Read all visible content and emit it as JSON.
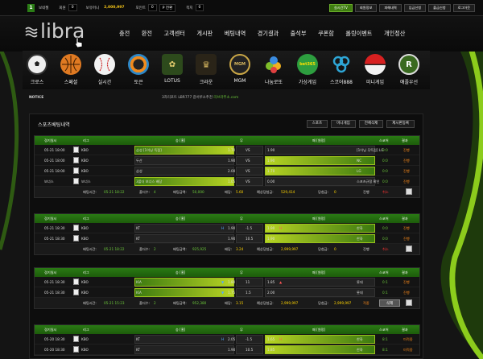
{
  "topbar": {
    "level": "1",
    "user_label": "보네젤",
    "hold_label": "회원",
    "hold_value": "0",
    "money_label": "보유머니",
    "money_value": "2,000,997",
    "point_label": "포인트",
    "point_value": "0",
    "p_btn": "P 전환",
    "note_label": "쪽지",
    "note_value": "0",
    "buttons": [
      "실시간TV",
      "회원정보",
      "피해내역",
      "입금신청",
      "출금신청",
      "로그아웃"
    ]
  },
  "logo": {
    "text": "libra"
  },
  "nav": [
    "충전",
    "환전",
    "고객센터",
    "게시판",
    "베팅내역",
    "경기결과",
    "출석부",
    "쿠폰함",
    "롤링이벤트",
    "개인정산"
  ],
  "games": [
    {
      "label": "크로스",
      "color": "#e8e8e8"
    },
    {
      "label": "스페셜",
      "color": "#e07a22"
    },
    {
      "label": "실시간",
      "color": "#eeeeee"
    },
    {
      "label": "토큰",
      "color": "#2e88c8"
    },
    {
      "label": "LOTUS",
      "color": "#3a6e2c"
    },
    {
      "label": "크라운",
      "color": "#3c3420"
    },
    {
      "label": "MGM",
      "color": "#2c2c2c"
    },
    {
      "label": "나눔로또",
      "color": "#7fbd2a"
    },
    {
      "label": "가상게임",
      "color": "#2d9e3f"
    },
    {
      "label": "스코어888",
      "color": "#2ea6d6"
    },
    {
      "label": "미니게임",
      "color": "#eeeeee"
    },
    {
      "label": "애플우선",
      "color": "#3a6a20"
    }
  ],
  "notice": {
    "label": "NOTICE",
    "text": "3차리포트 LBR777 갈서루소추천",
    "link": "리브라주소.com"
  },
  "panel": {
    "title": "스포츠베팅내역",
    "tabs": [
      "스포츠",
      "미니게임",
      "전체삭제",
      "제시판등록"
    ]
  },
  "headers": [
    "경기일시",
    "리그",
    "승 [홈]",
    "무",
    "패 [원정]",
    "스코어",
    "결과"
  ],
  "bets": [
    {
      "rows": [
        {
          "time": "05-21 18:00",
          "league": "KBO",
          "home": "삼성 [1이닝 득점]",
          "home_odds": "1.70",
          "draw": "VS",
          "away_odds": "1.90",
          "away": "[1이닝 무득점] LG",
          "score": "0:0",
          "result": "진행",
          "sel": "home"
        },
        {
          "time": "05-21 18:00",
          "league": "KBO",
          "home": "두산",
          "home_odds": "1.90",
          "draw": "VS",
          "away_odds": "1.90",
          "away": "NC",
          "score": "0:0",
          "result": "진행",
          "sel": "away"
        },
        {
          "time": "05-21 18:00",
          "league": "KBO",
          "home": "삼성",
          "home_odds": "2.00",
          "draw": "VS",
          "away_odds": "1.70",
          "away": "LG",
          "score": "0:0",
          "result": "진행",
          "sel": "away"
        },
        {
          "time": "보너스",
          "league": "보너스",
          "home": "3폴더 보너스 배당",
          "home_odds": "1.05",
          "draw": "VS",
          "away_odds": "0.00",
          "away": "스포츠규정 확인",
          "score": "0:0",
          "result": "진행",
          "sel": "home"
        }
      ],
      "foot": {
        "time_label": "배팅시간:",
        "time": "05-21 18:22",
        "folder_label": "폴더수:",
        "folder": "4",
        "amt_label": "배팅금액:",
        "amt": "50,000",
        "odds_label": "배당:",
        "odds": "5.60",
        "exp_label": "예상당첨금:",
        "exp": "529,414",
        "win_label": "당첨금:",
        "win": "0",
        "status": "진행",
        "cancel": "취소"
      }
    },
    {
      "rows": [
        {
          "time": "05-21 18:30",
          "league": "KBO",
          "home": "KT",
          "mark": "H",
          "home_odds": "1.90",
          "draw": "-1.5",
          "away_odds": "1.90",
          "away_mark": "H",
          "away": "한화",
          "score": "0:0",
          "result": "진행",
          "sel": "away"
        },
        {
          "time": "05-21 18:30",
          "league": "KBO",
          "home": "KT",
          "mark": "",
          "home_odds": "1.90",
          "draw": "10.5",
          "away_odds": "1.90",
          "away_mark": "",
          "away": "한화",
          "score": "0:0",
          "result": "진행",
          "sel": "away"
        }
      ],
      "foot": {
        "time_label": "배팅시간:",
        "time": "05-21 18:22",
        "folder_label": "폴더수:",
        "folder": "2",
        "amt_label": "배팅금액:",
        "amt": "925,925",
        "odds_label": "배당:",
        "odds": "3.24",
        "exp_label": "예상당첨금:",
        "exp": "2,999,997",
        "win_label": "당첨금:",
        "win": "0",
        "status": "진행",
        "cancel": "취소"
      }
    },
    {
      "rows": [
        {
          "time": "05-21 18:30",
          "league": "KBO",
          "home": "KIA",
          "mark": "▼",
          "home_odds": "1.80",
          "draw": "11",
          "away_odds": "1.85",
          "away_mark": "▲",
          "away": "롯데",
          "score": "0:1",
          "result": "진행",
          "sel": "home"
        },
        {
          "time": "05-21 18:30",
          "league": "KBO",
          "home": "KIA",
          "mark": "▼",
          "home_odds": "1.75",
          "draw": "1.5",
          "away_odds": "2.00",
          "away_mark": "",
          "away": "롯데",
          "score": "0:1",
          "result": "진행",
          "sel": "home"
        }
      ],
      "foot": {
        "time_label": "배팅시간:",
        "time": "05-21 15:23",
        "folder_label": "폴더수:",
        "folder": "2",
        "amt_label": "배팅금액:",
        "amt": "952,380",
        "odds_label": "배당:",
        "odds": "3.15",
        "exp_label": "예상당첨금:",
        "exp": "2,999,997",
        "win_label": "당첨금:",
        "win": "2,999,997",
        "status": "적중",
        "cancel": "삭제"
      }
    },
    {
      "rows": [
        {
          "time": "05-20 18:30",
          "league": "KBO",
          "home": "KT",
          "mark": "H",
          "home_odds": "2.05",
          "draw": "-1.5",
          "away_odds": "1.65",
          "away_mark": "H",
          "away": "한화",
          "score": "8:1",
          "result": "미적중",
          "sel": "away"
        },
        {
          "time": "05-20 18:30",
          "league": "KBO",
          "home": "KT",
          "mark": "",
          "home_odds": "1.90",
          "draw": "10.5",
          "away_odds": "1.85",
          "away_mark": "",
          "away": "한화",
          "score": "8:1",
          "result": "미적중",
          "sel": "away"
        }
      ],
      "foot": null
    }
  ],
  "overlay": {
    "bonus": "3폴더 보너스 배당",
    "rules": "스포츠규정 확인"
  }
}
